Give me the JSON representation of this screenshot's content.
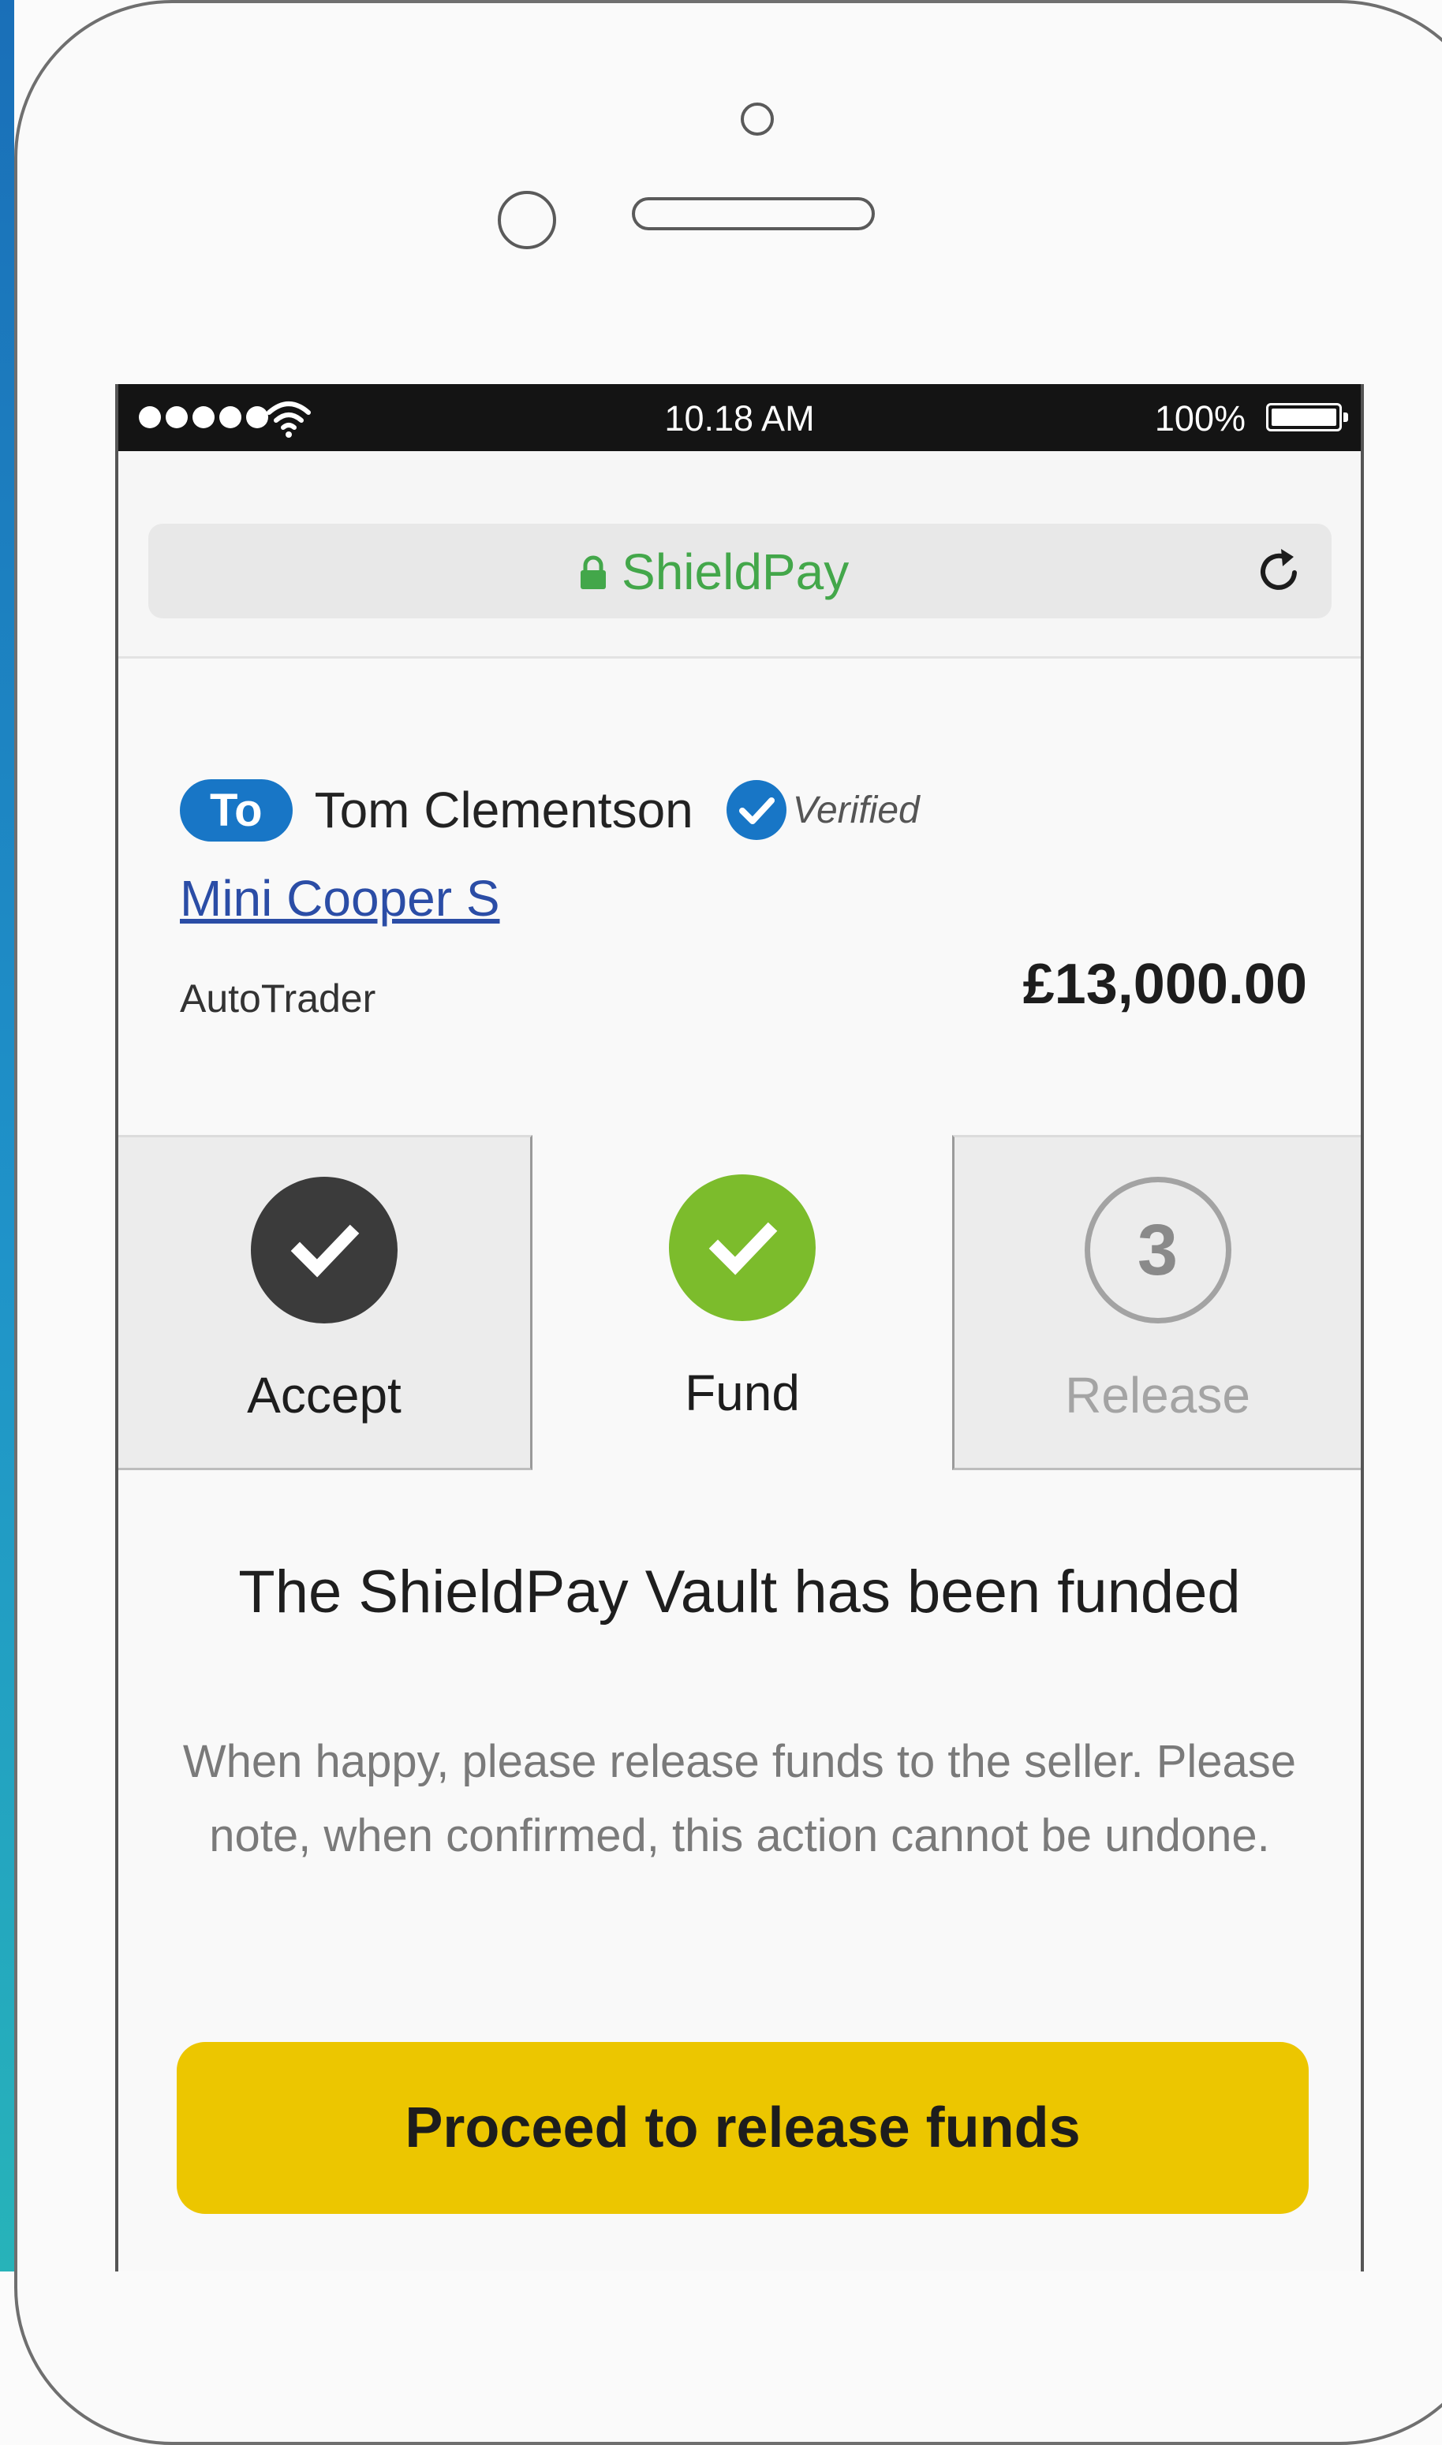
{
  "status_bar": {
    "time": "10.18 AM",
    "battery_percent": "100%",
    "signal_bars": 5,
    "battery_level": 1.0
  },
  "browser": {
    "url_label": "ShieldPay",
    "secure_icon": "lock-icon",
    "reload_icon": "reload-icon"
  },
  "transaction": {
    "recipient_prefix": "To",
    "recipient_name": "Tom Clementson",
    "verified_label": "Verified",
    "item_name": "Mini Cooper S",
    "marketplace": "AutoTrader",
    "amount": "£13,000.00"
  },
  "steps": [
    {
      "label": "Accept",
      "state": "done"
    },
    {
      "label": "Fund",
      "state": "current"
    },
    {
      "label": "Release",
      "number": "3",
      "state": "pending"
    }
  ],
  "status": {
    "heading": "The ShieldPay Vault has been funded",
    "body": "When happy, please release funds to the seller. Please note, when confirmed, this action cannot be undone."
  },
  "actions": {
    "proceed_label": "Proceed to release funds"
  },
  "colors": {
    "brand_blue": "#1876c6",
    "secure_green": "#43a74a",
    "step_done": "#3b3b3b",
    "step_current": "#7cbc2c",
    "button_yellow": "#ecc600"
  }
}
